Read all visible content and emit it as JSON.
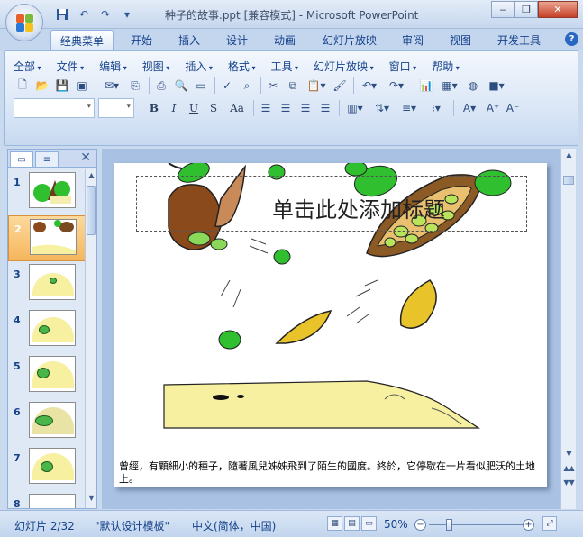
{
  "window": {
    "title": "种子的故事.ppt [兼容模式] - Microsoft PowerPoint",
    "controls": [
      "minimize",
      "restore",
      "close"
    ]
  },
  "quick_access": [
    "save-icon",
    "undo-icon",
    "redo-icon",
    "customize-icon"
  ],
  "ribbon_tabs": [
    {
      "label": "经典菜单",
      "active": true
    },
    {
      "label": "开始"
    },
    {
      "label": "插入"
    },
    {
      "label": "设计"
    },
    {
      "label": "动画"
    },
    {
      "label": "幻灯片放映"
    },
    {
      "label": "审阅"
    },
    {
      "label": "视图"
    },
    {
      "label": "开发工具"
    }
  ],
  "menus": [
    "全部",
    "文件",
    "编辑",
    "视图",
    "插入",
    "格式",
    "工具",
    "幻灯片放映",
    "窗口",
    "帮助"
  ],
  "format_buttons": [
    "B",
    "I",
    "U",
    "S",
    "Aa"
  ],
  "slides_pane": {
    "tabs": [
      "slides-tab",
      "outline-tab"
    ],
    "items": [
      {
        "num": "1"
      },
      {
        "num": "2",
        "selected": true
      },
      {
        "num": "3"
      },
      {
        "num": "4"
      },
      {
        "num": "5"
      },
      {
        "num": "6"
      },
      {
        "num": "7"
      },
      {
        "num": "8"
      }
    ]
  },
  "slide": {
    "title_placeholder": "单击此处添加标题",
    "caption": "曾經，有顆細小的種子，隨著風兒姊姊飛到了陌生的國度。終於，它停歇在一片看似肥沃的土地上。"
  },
  "status": {
    "slide_info": "幻灯片 2/32",
    "theme": "\"默认设计模板\"",
    "language": "中文(简体，中国)",
    "zoom": "50%"
  },
  "colors": {
    "ribbon": "#d7e4f5",
    "selected_thumb": "#f6b65c",
    "soil": "#f6f0a0",
    "leaf_green": "#2fbf2f"
  }
}
